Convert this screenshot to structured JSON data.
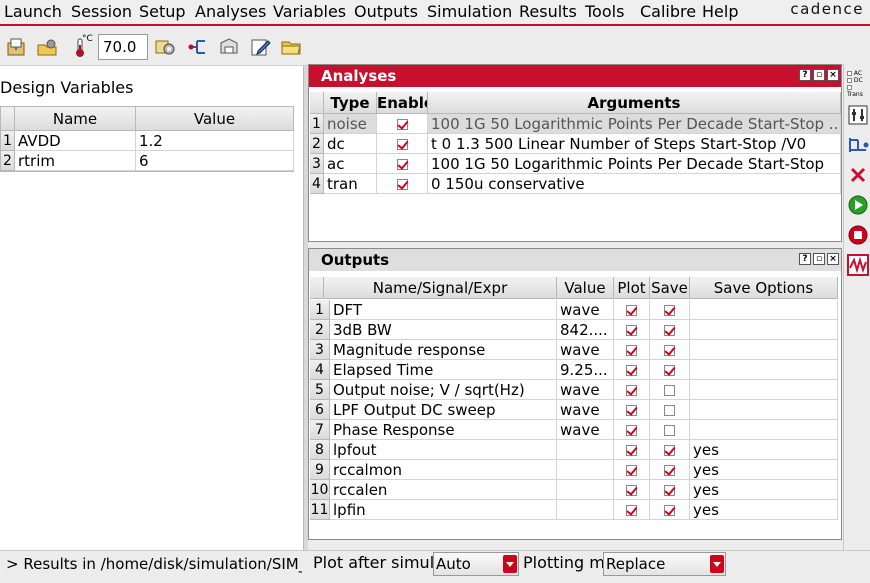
{
  "menubar": {
    "items": [
      "Launch",
      "Session",
      "Setup",
      "Analyses",
      "Variables",
      "Outputs",
      "Simulation",
      "Results",
      "Tools",
      "Calibre",
      "Help"
    ],
    "brand": "cadence"
  },
  "toolbar": {
    "temperature_value": "70.0",
    "temperature_unit": "°C",
    "icons": [
      "open-session-icon",
      "load-state-icon",
      "thermometer-icon",
      "setup-icon",
      "netlist-icon",
      "save-state-icon",
      "edit-icon",
      "open-folder-icon"
    ]
  },
  "design_variables": {
    "title": "Design Variables",
    "columns": [
      "Name",
      "Value"
    ],
    "rows": [
      {
        "num": "1",
        "name": "AVDD",
        "value": "1.2"
      },
      {
        "num": "2",
        "name": "rtrim",
        "value": "6"
      }
    ]
  },
  "analyses": {
    "title": "Analyses",
    "columns": [
      "Type",
      "Enable",
      "Arguments"
    ],
    "rows": [
      {
        "num": "1",
        "type": "noise",
        "enabled": true,
        "args": "100 1G 50 Logarithmic Points Per Decade Start-Stop ...",
        "selected": true
      },
      {
        "num": "2",
        "type": "dc",
        "enabled": true,
        "args": "t 0 1.3 500 Linear Number of Steps Start-Stop /V0",
        "selected": false
      },
      {
        "num": "3",
        "type": "ac",
        "enabled": true,
        "args": "100 1G 50 Logarithmic Points Per Decade Start-Stop",
        "selected": false
      },
      {
        "num": "4",
        "type": "tran",
        "enabled": true,
        "args": "0 150u conservative",
        "selected": false
      }
    ]
  },
  "outputs": {
    "title": "Outputs",
    "columns": [
      "Name/Signal/Expr",
      "Value",
      "Plot",
      "Save",
      "Save Options"
    ],
    "rows": [
      {
        "num": "1",
        "name": "DFT",
        "value": "wave",
        "plot": true,
        "save": true,
        "options": ""
      },
      {
        "num": "2",
        "name": "3dB BW",
        "value": "842....",
        "plot": true,
        "save": true,
        "options": ""
      },
      {
        "num": "3",
        "name": "Magnitude response",
        "value": "wave",
        "plot": true,
        "save": true,
        "options": ""
      },
      {
        "num": "4",
        "name": "Elapsed Time",
        "value": "9.25...",
        "plot": true,
        "save": true,
        "options": ""
      },
      {
        "num": "5",
        "name": "Output noise; V / sqrt(Hz)",
        "value": "wave",
        "plot": true,
        "save": false,
        "options": ""
      },
      {
        "num": "6",
        "name": "LPF Output DC sweep",
        "value": "wave",
        "plot": true,
        "save": false,
        "options": ""
      },
      {
        "num": "7",
        "name": "Phase Response",
        "value": "wave",
        "plot": true,
        "save": false,
        "options": ""
      },
      {
        "num": "8",
        "name": "lpfout",
        "value": "",
        "plot": true,
        "save": true,
        "options": "yes"
      },
      {
        "num": "9",
        "name": "rccalmon",
        "value": "",
        "plot": true,
        "save": true,
        "options": "yes"
      },
      {
        "num": "10",
        "name": "rccalen",
        "value": "",
        "plot": true,
        "save": true,
        "options": "yes"
      },
      {
        "num": "11",
        "name": "lpfin",
        "value": "",
        "plot": true,
        "save": true,
        "options": "yes"
      }
    ]
  },
  "right_toolbar": {
    "icons": [
      "choose-analyses-icon",
      "edit-variables-icon",
      "setup-outputs-icon",
      "delete-icon",
      "run-simulation-icon",
      "stop-simulation-icon",
      "plot-outputs-icon"
    ],
    "analysis_labels": [
      "AC",
      "DC",
      "Trans"
    ]
  },
  "statusbar": {
    "results_text": "> Results in /home/disk/simulation/SIM_",
    "plot_after_label": "Plot after simula",
    "plot_after_value": "Auto",
    "plotting_mode_label": "Plotting mo",
    "plotting_mode_value": "Replace"
  },
  "colors": {
    "accent": "#c8102e",
    "check": "#d0021b"
  }
}
